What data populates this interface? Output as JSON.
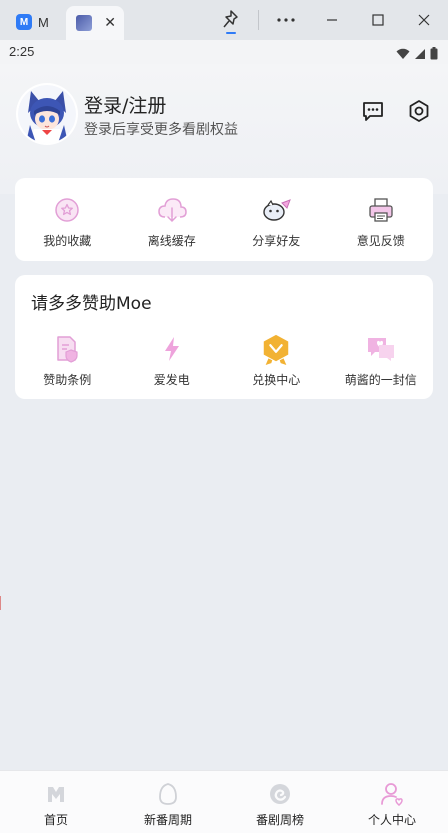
{
  "browser": {
    "tab1_label": "M",
    "tab1_logo": "M",
    "tab2_close": "✕",
    "accent": "#2f7bf6"
  },
  "status": {
    "time": "2:25"
  },
  "profile": {
    "title": "登录/注册",
    "subtitle": "登录后享受更多看剧权益",
    "avatar_icon": "anime-avatar-icon"
  },
  "quick_actions": [
    {
      "label": "我的收藏",
      "icon": "favorite-icon"
    },
    {
      "label": "离线缓存",
      "icon": "cloud-download-icon"
    },
    {
      "label": "分享好友",
      "icon": "share-friend-icon"
    },
    {
      "label": "意见反馈",
      "icon": "feedback-printer-icon"
    }
  ],
  "sponsor": {
    "title": "请多多赞助Moe",
    "items": [
      {
        "label": "赞助条例",
        "icon": "document-shield-icon"
      },
      {
        "label": "爱发电",
        "icon": "lightning-icon"
      },
      {
        "label": "兑换中心",
        "icon": "badge-exchange-icon"
      },
      {
        "label": "萌酱的一封信",
        "icon": "letter-heart-icon"
      }
    ]
  },
  "bottom_nav": [
    {
      "label": "首页",
      "icon": "home-m-icon"
    },
    {
      "label": "新番周期",
      "icon": "egg-icon"
    },
    {
      "label": "番剧周榜",
      "icon": "swirl-icon"
    },
    {
      "label": "个人中心",
      "icon": "user-heart-icon"
    }
  ],
  "colors": {
    "pink": "#e89ad6",
    "orange": "#f2b233",
    "page_bg": "#eaedf2"
  }
}
